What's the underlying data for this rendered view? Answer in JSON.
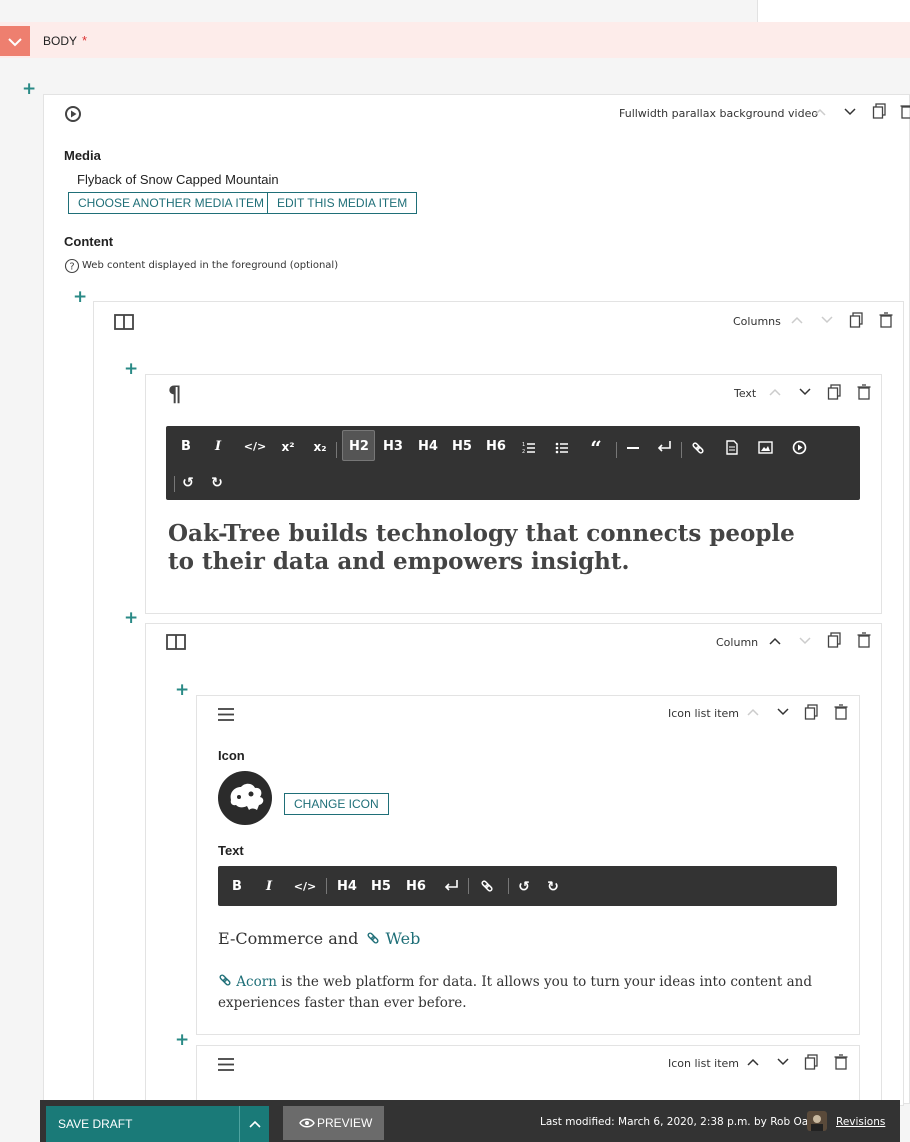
{
  "body_section": {
    "label": "BODY",
    "required_mark": "*"
  },
  "outer_paragraph": {
    "type_label": "Fullwidth parallax background video",
    "media_label": "Media",
    "media_name": "Flyback of Snow Capped Mountain",
    "choose_btn": "CHOOSE ANOTHER MEDIA ITEM",
    "edit_btn": "EDIT THIS MEDIA ITEM",
    "content_label": "Content",
    "content_help": "Web content displayed in the foreground (optional)"
  },
  "columns_paragraph": {
    "type_label": "Columns"
  },
  "text_paragraph": {
    "type_label": "Text",
    "toolbar": [
      "B",
      "I",
      "</>",
      "x²",
      "x₂",
      "H2",
      "H3",
      "H4",
      "H5",
      "H6"
    ],
    "active_button": "H2",
    "heading": "Oak-Tree builds technology that connects people to their data and empowers insight."
  },
  "column_paragraph": {
    "type_label": "Column"
  },
  "icon_list_item": {
    "type_label": "Icon list item",
    "icon_label": "Icon",
    "change_icon_btn": "CHANGE ICON",
    "text_label": "Text",
    "toolbar": [
      "B",
      "I",
      "</>",
      "H4",
      "H5",
      "H6"
    ],
    "line1_text": "E-Commerce and",
    "line1_link": "Web",
    "para_link": "Acorn",
    "para_line1": "is the web platform for data. It allows you to turn your ideas into content and",
    "para_line2": "experiences faster than ever before."
  },
  "icon_list_item_2": {
    "type_label": "Icon list item"
  },
  "bottom_bar": {
    "save_label": "SAVE DRAFT",
    "preview_label": "PREVIEW",
    "last_modified": "Last modified: March 6, 2020, 2:38 p.m. by Rob Oakes",
    "revisions_label": "Revisions"
  },
  "colors": {
    "accent": "#1f6f78",
    "plus": "#2a8a86",
    "body_bar": "#fdecea",
    "toggle": "#ee7f6f",
    "toolbar": "#333333",
    "save": "#1a7a78"
  }
}
